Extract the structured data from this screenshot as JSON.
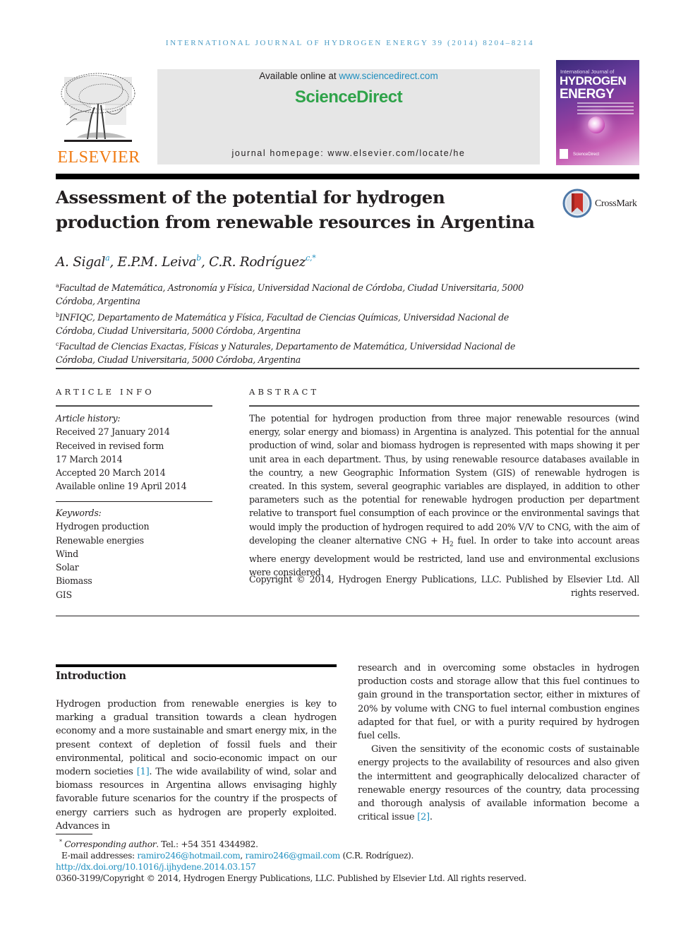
{
  "running_header": "International Journal of Hydrogen Energy 39 (2014) 8204–8214",
  "masthead": {
    "publisher": "ELSEVIER",
    "available_online_prefix": "Available online at ",
    "available_online_link": "www.sciencedirect.com",
    "sciencedirect_logo": "ScienceDirect",
    "journal_homepage": "journal homepage: www.elsevier.com/locate/he",
    "cover": {
      "title_small": "International Journal of",
      "title_line1": "HYDROGEN",
      "title_line2": "ENERGY",
      "footer": "ScienceDirect"
    },
    "colors": {
      "elsevier_orange": "#f07b13",
      "sciencedirect_green": "#2fa34a",
      "link_blue": "#1f8fbf",
      "banner_gray": "#e6e6e6"
    }
  },
  "article": {
    "title": "Assessment of the potential for hydrogen production from renewable resources in Argentina",
    "crossmark_label": "CrossMark",
    "authors": [
      {
        "name": "A. Sigal",
        "affil": "a",
        "sep": ", "
      },
      {
        "name": "E.P.M. Leiva",
        "affil": "b",
        "sep": ", "
      },
      {
        "name": "C.R. Rodríguez",
        "affil": "c,*",
        "sep": ""
      }
    ],
    "affiliations": [
      {
        "mark": "a",
        "text": "Facultad de Matemática, Astronomía y Física, Universidad Nacional de Córdoba, Ciudad Universitaria, 5000 Córdoba, Argentina"
      },
      {
        "mark": "b",
        "text": "INFIQC, Departamento de Matemática y Física, Facultad de Ciencias Químicas, Universidad Nacional de Córdoba, Ciudad Universitaria, 5000 Córdoba, Argentina"
      },
      {
        "mark": "c",
        "text": "Facultad de Ciencias Exactas, Físicas y Naturales, Departamento de Matemática, Universidad Nacional de Córdoba, Ciudad Universitaria, 5000 Córdoba, Argentina"
      }
    ]
  },
  "article_info": {
    "heading": "ARTICLE INFO",
    "history_label": "Article history:",
    "history": [
      "Received 27 January 2014",
      "Received in revised form",
      "17 March 2014",
      "Accepted 20 March 2014",
      "Available online 19 April 2014"
    ],
    "keywords_label": "Keywords:",
    "keywords": [
      "Hydrogen production",
      "Renewable energies",
      "Wind",
      "Solar",
      "Biomass",
      "GIS"
    ]
  },
  "abstract": {
    "heading": "ABSTRACT",
    "text_part1": "The potential for hydrogen production from three major renewable resources (wind energy, solar energy and biomass) in Argentina is analyzed. This potential for the annual production of wind, solar and biomass hydrogen is represented with maps showing it per unit area in each department. Thus, by using renewable resource databases available in the country, a new Geographic Information System (GIS) of renewable hydrogen is created. In this system, several geographic variables are displayed, in addition to other parameters such as the potential for renewable hydrogen production per department relative to transport fuel consumption of each province or the environmental savings that would imply the production of hydrogen required to add 20% V/V to CNG, with the aim of developing the cleaner alternative CNG + H",
    "text_sub": "2",
    "text_part2": " fuel. In order to take into account areas where energy development would be restricted, land use and environmental exclusions were considered.",
    "copyright": "Copyright © 2014, Hydrogen Energy Publications, LLC. Published by Elsevier Ltd. All rights reserved."
  },
  "introduction": {
    "heading": "Introduction",
    "col1_before_ref": "Hydrogen production from renewable energies is key to marking a gradual transition towards a clean hydrogen economy and a more sustainable and smart energy mix, in the present context of depletion of fossil fuels and their environmental, political and socio-economic impact on our modern societies ",
    "col1_ref": "[1]",
    "col1_after_ref": ". The wide availability of wind, solar and biomass resources in Argentina allows envisaging highly favorable future scenarios for the country if the prospects of energy carriers such as hydrogen are properly exploited. Advances in",
    "col2_para1": "research and in overcoming some obstacles in hydrogen production costs and storage allow that this fuel continues to gain ground in the transportation sector, either in mixtures of 20% by volume with CNG to fuel internal combustion engines adapted for that fuel, or with a purity required by hydrogen fuel cells.",
    "col2_para2_before_ref": "Given the sensitivity of the economic costs of sustainable energy projects to the availability of resources and also given the intermittent and geographically delocalized character of renewable energy resources of the country, data processing and thorough analysis of available information become a critical issue ",
    "col2_para2_ref": "[2]",
    "col2_para2_after_ref": "."
  },
  "footnotes": {
    "star": "*",
    "corresponding_label": "Corresponding author",
    "phone": ". Tel.: +54 351 4344982.",
    "email_label": "E-mail addresses: ",
    "email1": "ramiro246@hotmail.com",
    "email_sep": ", ",
    "email2": "ramiro246@gmail.com",
    "email_owner": " (C.R. Rodríguez).",
    "doi": "http://dx.doi.org/10.1016/j.ijhydene.2014.03.157",
    "issn_copyright": "0360-3199/Copyright © 2014, Hydrogen Energy Publications, LLC. Published by Elsevier Ltd. All rights reserved."
  }
}
